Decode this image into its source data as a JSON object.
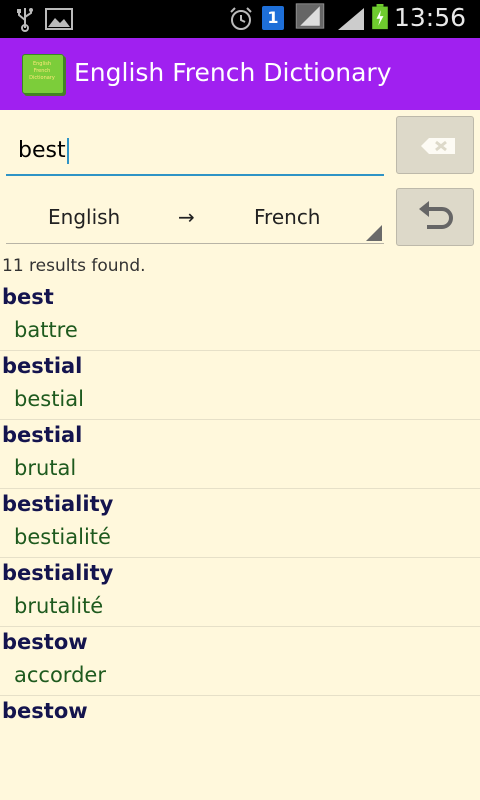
{
  "statusbar": {
    "time": "13:56",
    "icons": [
      "usb-icon",
      "image-icon",
      "alarm-icon",
      "sim-1-icon",
      "signal-icon",
      "signal-icon",
      "battery-charging-icon"
    ],
    "sim_label": "1"
  },
  "appbar": {
    "title": "English French Dictionary",
    "icon_text": "English French Dictionary"
  },
  "search": {
    "value": "best",
    "clear_icon": "backspace-icon"
  },
  "language": {
    "from": "English",
    "arrow": "→",
    "to": "French",
    "swap_icon": "undo-icon"
  },
  "results_count": "11 results found.",
  "results": [
    {
      "word": "best",
      "translation": "battre"
    },
    {
      "word": "bestial",
      "translation": "bestial"
    },
    {
      "word": "bestial",
      "translation": "brutal"
    },
    {
      "word": "bestiality",
      "translation": "bestialité"
    },
    {
      "word": "bestiality",
      "translation": "brutalité"
    },
    {
      "word": "bestow",
      "translation": "accorder"
    },
    {
      "word": "bestow",
      "translation": ""
    }
  ],
  "colors": {
    "appbar": "#a020f0",
    "background": "#fff8dc",
    "word": "#14144e",
    "translation": "#1e5a1e",
    "accent": "#2f94c6"
  }
}
